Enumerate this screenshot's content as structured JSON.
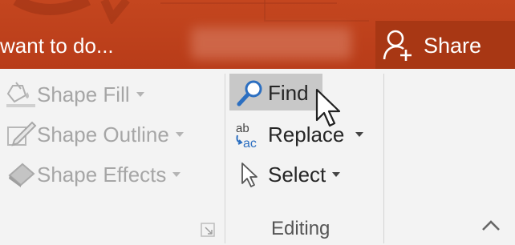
{
  "titlebar": {
    "tell_me_text": "want to do...",
    "share_label": "Share",
    "share_icon": "person-add-icon"
  },
  "ribbon": {
    "drawing_group": {
      "items": [
        {
          "label": "Shape Fill",
          "icon": "paint-bucket-icon",
          "enabled": false,
          "has_dropdown": true
        },
        {
          "label": "Shape Outline",
          "icon": "pencil-icon",
          "enabled": false,
          "has_dropdown": true
        },
        {
          "label": "Shape Effects",
          "icon": "eraser-effects-icon",
          "enabled": false,
          "has_dropdown": true
        }
      ],
      "launcher_icon": "dialog-launcher-icon"
    },
    "editing_group": {
      "label": "Editing",
      "items": [
        {
          "label": "Find",
          "icon": "magnifier-icon",
          "enabled": true,
          "highlighted": true,
          "has_dropdown": false
        },
        {
          "label": "Replace",
          "icon": "replace-ab-ac-icon",
          "glyph_top": "ab",
          "glyph_bottom": "ac",
          "enabled": true,
          "has_dropdown": true
        },
        {
          "label": "Select",
          "icon": "select-pointer-icon",
          "enabled": true,
          "has_dropdown": true
        }
      ]
    },
    "collapse_icon": "chevron-up-icon"
  },
  "colors": {
    "title_bar": "#b83c19",
    "share_bg": "#a83714",
    "disabled_text": "#a6a6a6",
    "enabled_text": "#262626",
    "find_icon_blue": "#2c6fc1",
    "hover_highlight": "#c8c8c8"
  }
}
